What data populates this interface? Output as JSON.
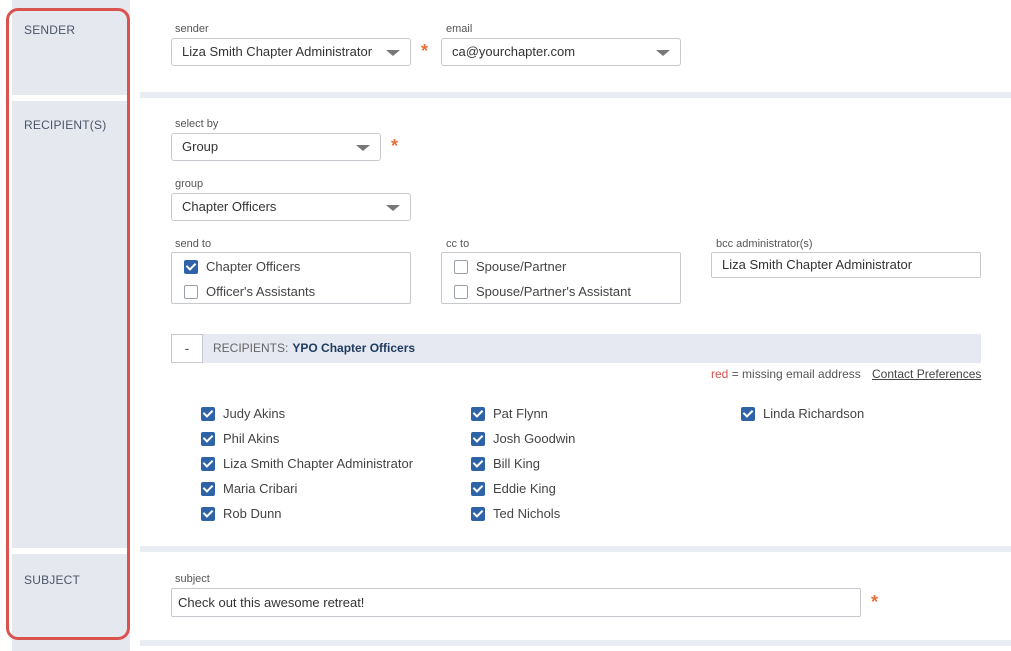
{
  "sections": {
    "sender": "SENDER",
    "recipients": "RECIPIENT(S)",
    "subject": "SUBJECT"
  },
  "sender": {
    "sender_label": "sender",
    "sender_value": "Liza Smith Chapter Administrator",
    "email_label": "email",
    "email_value": "ca@yourchapter.com",
    "required_mark": "*"
  },
  "recipients": {
    "select_by_label": "select by",
    "select_by_value": "Group",
    "group_label": "group",
    "group_value": "Chapter Officers",
    "send_to_label": "send to",
    "send_to_options": [
      {
        "label": "Chapter Officers",
        "checked": true
      },
      {
        "label": "Officer's Assistants",
        "checked": false
      }
    ],
    "cc_to_label": "cc to",
    "cc_to_options": [
      {
        "label": "Spouse/Partner",
        "checked": false
      },
      {
        "label": "Spouse/Partner's Assistant",
        "checked": false
      }
    ],
    "bcc_label": "bcc administrator(s)",
    "bcc_value": "Liza Smith Chapter Administrator",
    "collapse_label": "-",
    "header_prefix": "RECIPIENTS:",
    "header_group": "YPO Chapter Officers",
    "legend_red": "red",
    "legend_text": "= missing email address",
    "contact_prefs": "Contact Preferences",
    "list": [
      [
        "Judy Akins",
        "Phil Akins",
        "Liza Smith Chapter Administrator",
        "Maria Cribari",
        "Rob Dunn"
      ],
      [
        "Pat Flynn",
        "Josh Goodwin",
        "Bill King",
        "Eddie King",
        "Ted Nichols"
      ],
      [
        "Linda Richardson"
      ]
    ]
  },
  "subject": {
    "label": "subject",
    "value": "Check out this awesome retreat!"
  },
  "colors": {
    "accent": "#2f63a8",
    "required": "#e8703a",
    "highlight": "#d9534f",
    "label_column": "#e6e8f0"
  }
}
